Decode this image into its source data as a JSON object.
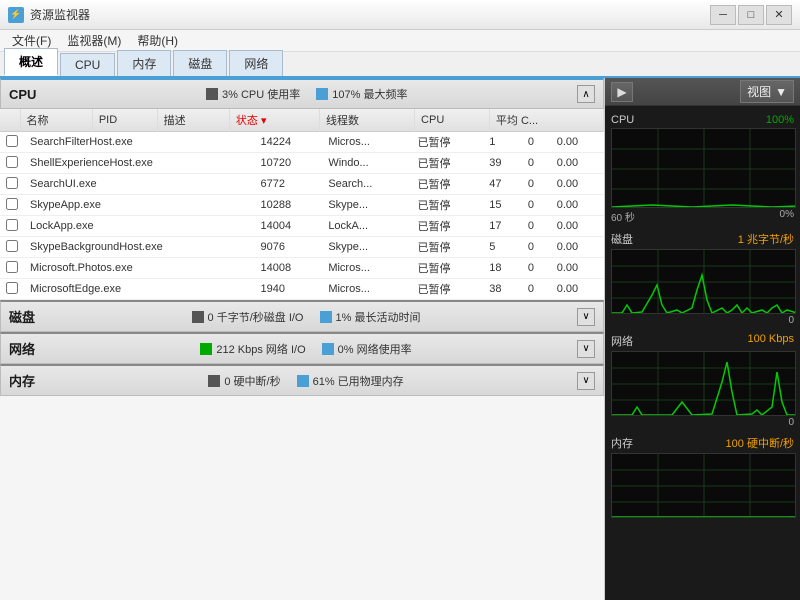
{
  "window": {
    "title": "资源监视器",
    "icon": "⚡"
  },
  "title_buttons": {
    "minimize": "─",
    "maximize": "□",
    "close": "✕"
  },
  "menu": {
    "items": [
      "文件(F)",
      "监视器(M)",
      "帮助(H)"
    ]
  },
  "tabs": [
    {
      "label": "概述",
      "active": true
    },
    {
      "label": "CPU",
      "active": false
    },
    {
      "label": "内存",
      "active": false
    },
    {
      "label": "磁盘",
      "active": false
    },
    {
      "label": "网络",
      "active": false
    }
  ],
  "cpu_section": {
    "title": "CPU",
    "stat1_label": "3% CPU 使用率",
    "stat2_label": "107% 最大频率",
    "columns": [
      "",
      "名称",
      "PID",
      "描述",
      "状态",
      "线程数",
      "CPU",
      "平均 C..."
    ],
    "processes": [
      {
        "name": "SearchFilterHost.exe",
        "pid": "14224",
        "desc": "Micros...",
        "status": "已暂停",
        "threads": "1",
        "cpu": "0",
        "avg": "0.00"
      },
      {
        "name": "ShellExperienceHost.exe",
        "pid": "10720",
        "desc": "Windo...",
        "status": "已暂停",
        "threads": "39",
        "cpu": "0",
        "avg": "0.00"
      },
      {
        "name": "SearchUI.exe",
        "pid": "6772",
        "desc": "Search...",
        "status": "已暂停",
        "threads": "47",
        "cpu": "0",
        "avg": "0.00"
      },
      {
        "name": "SkypeApp.exe",
        "pid": "10288",
        "desc": "Skype...",
        "status": "已暂停",
        "threads": "15",
        "cpu": "0",
        "avg": "0.00"
      },
      {
        "name": "LockApp.exe",
        "pid": "14004",
        "desc": "LockA...",
        "status": "已暂停",
        "threads": "17",
        "cpu": "0",
        "avg": "0.00"
      },
      {
        "name": "SkypeBackgroundHost.exe",
        "pid": "9076",
        "desc": "Skype...",
        "status": "已暂停",
        "threads": "5",
        "cpu": "0",
        "avg": "0.00"
      },
      {
        "name": "Microsoft.Photos.exe",
        "pid": "14008",
        "desc": "Micros...",
        "status": "已暂停",
        "threads": "18",
        "cpu": "0",
        "avg": "0.00"
      },
      {
        "name": "MicrosoftEdge.exe",
        "pid": "1940",
        "desc": "Micros...",
        "status": "已暂停",
        "threads": "38",
        "cpu": "0",
        "avg": "0.00"
      }
    ]
  },
  "disk_section": {
    "title": "磁盘",
    "stat1_label": "0 千字节/秒磁盘 I/O",
    "stat2_label": "1% 最长活动时间"
  },
  "network_section": {
    "title": "网络",
    "stat1_label": "212 Kbps 网络 I/O",
    "stat2_label": "0% 网络使用率"
  },
  "memory_section": {
    "title": "内存",
    "stat1_label": "0 硬中断/秒",
    "stat2_label": "61% 已用物理内存"
  },
  "right_panel": {
    "view_label": "视图",
    "charts": [
      {
        "name": "CPU",
        "value": "100%",
        "bottom_left": "60 秒",
        "bottom_right": "0%"
      },
      {
        "name": "磁盘",
        "value": "1 兆字节/秒",
        "bottom_left": "",
        "bottom_right": "0"
      },
      {
        "name": "网络",
        "value": "100 Kbps",
        "bottom_left": "",
        "bottom_right": "0"
      },
      {
        "name": "内存",
        "value": "100 硬中断/秒",
        "bottom_left": "",
        "bottom_right": ""
      }
    ]
  }
}
